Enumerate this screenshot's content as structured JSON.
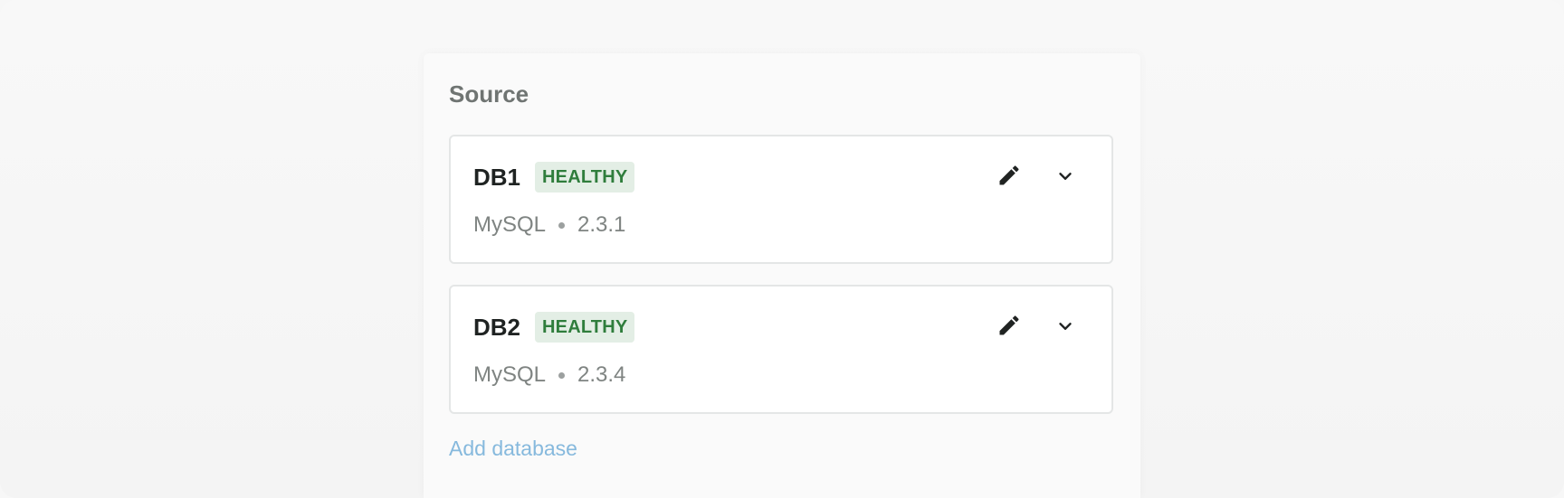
{
  "section": {
    "title": "Source"
  },
  "databases": [
    {
      "name": "DB1",
      "status": "HEALTHY",
      "engine": "MySQL",
      "version": "2.3.1",
      "edit_icon": "pencil-icon",
      "expand_icon": "chevron-down-icon"
    },
    {
      "name": "DB2",
      "status": "HEALTHY",
      "engine": "MySQL",
      "version": "2.3.4",
      "edit_icon": "pencil-icon",
      "expand_icon": "chevron-down-icon"
    }
  ],
  "actions": {
    "add_database": "Add database"
  },
  "colors": {
    "healthy_bg": "#e3eee5",
    "healthy_text": "#2f7d3c",
    "link": "#86b9dd",
    "title": "#6f7472"
  }
}
